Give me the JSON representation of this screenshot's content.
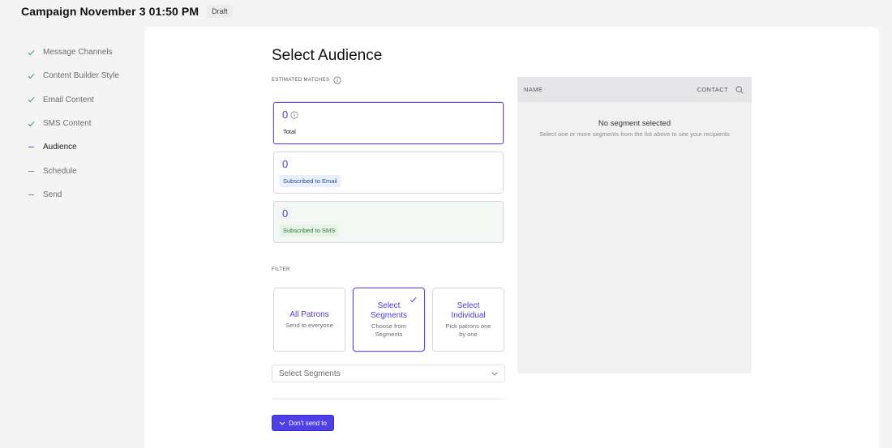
{
  "header": {
    "title": "Campaign November 3 01:50 PM",
    "badge": "Draft"
  },
  "sidebar": {
    "steps": [
      {
        "label": "Message Channels",
        "state": "done"
      },
      {
        "label": "Content Builder Style",
        "state": "done"
      },
      {
        "label": "Email Content",
        "state": "done"
      },
      {
        "label": "SMS Content",
        "state": "done"
      },
      {
        "label": "Audience",
        "state": "active"
      },
      {
        "label": "Schedule",
        "state": "pending"
      },
      {
        "label": "Send",
        "state": "pending"
      }
    ]
  },
  "main": {
    "title": "Select Audience",
    "estimated_label": "ESTIMATED MATCHES",
    "cards": [
      {
        "value": "0",
        "label": "Total"
      },
      {
        "value": "0",
        "label": "Subscribed to Email"
      },
      {
        "value": "0",
        "label": "Subscribed to SMS"
      }
    ],
    "filter_label": "FILTER",
    "filter_options": [
      {
        "title": "All Patrons",
        "subtitle": "Send to everyone"
      },
      {
        "title": "Select Segments",
        "subtitle": "Choose from Segments"
      },
      {
        "title": "Select Individual",
        "subtitle": "Pick patrons one by one"
      }
    ],
    "segments_select": {
      "placeholder": "Select Segments"
    },
    "dont_send_button": "Don't send to"
  },
  "panel": {
    "col_name": "NAME",
    "col_contact": "CONTACT",
    "empty_title": "No segment selected",
    "empty_subtitle": "Select one or more segments from the list above to see your recipients"
  },
  "colors": {
    "accent": "#5b4fe0",
    "success": "#3aa35a"
  },
  "icons": {
    "done": "check-icon",
    "pending": "dash-icon",
    "info": "info-icon",
    "search": "search-icon",
    "chevron": "chevron-down-icon"
  }
}
